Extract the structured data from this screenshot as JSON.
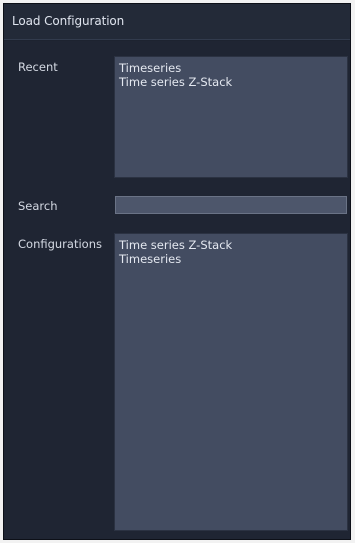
{
  "dialog": {
    "title": "Load Configuration"
  },
  "recent": {
    "label": "Recent",
    "items": [
      "Timeseries",
      "Time series Z-Stack"
    ]
  },
  "search": {
    "label": "Search",
    "value": "",
    "placeholder": ""
  },
  "configurations": {
    "label": "Configurations",
    "items": [
      "Time series Z-Stack",
      "Timeseries"
    ]
  },
  "colors": {
    "window_bg": "#1d2330",
    "list_bg": "#434c61",
    "text": "#e4e8f0"
  }
}
